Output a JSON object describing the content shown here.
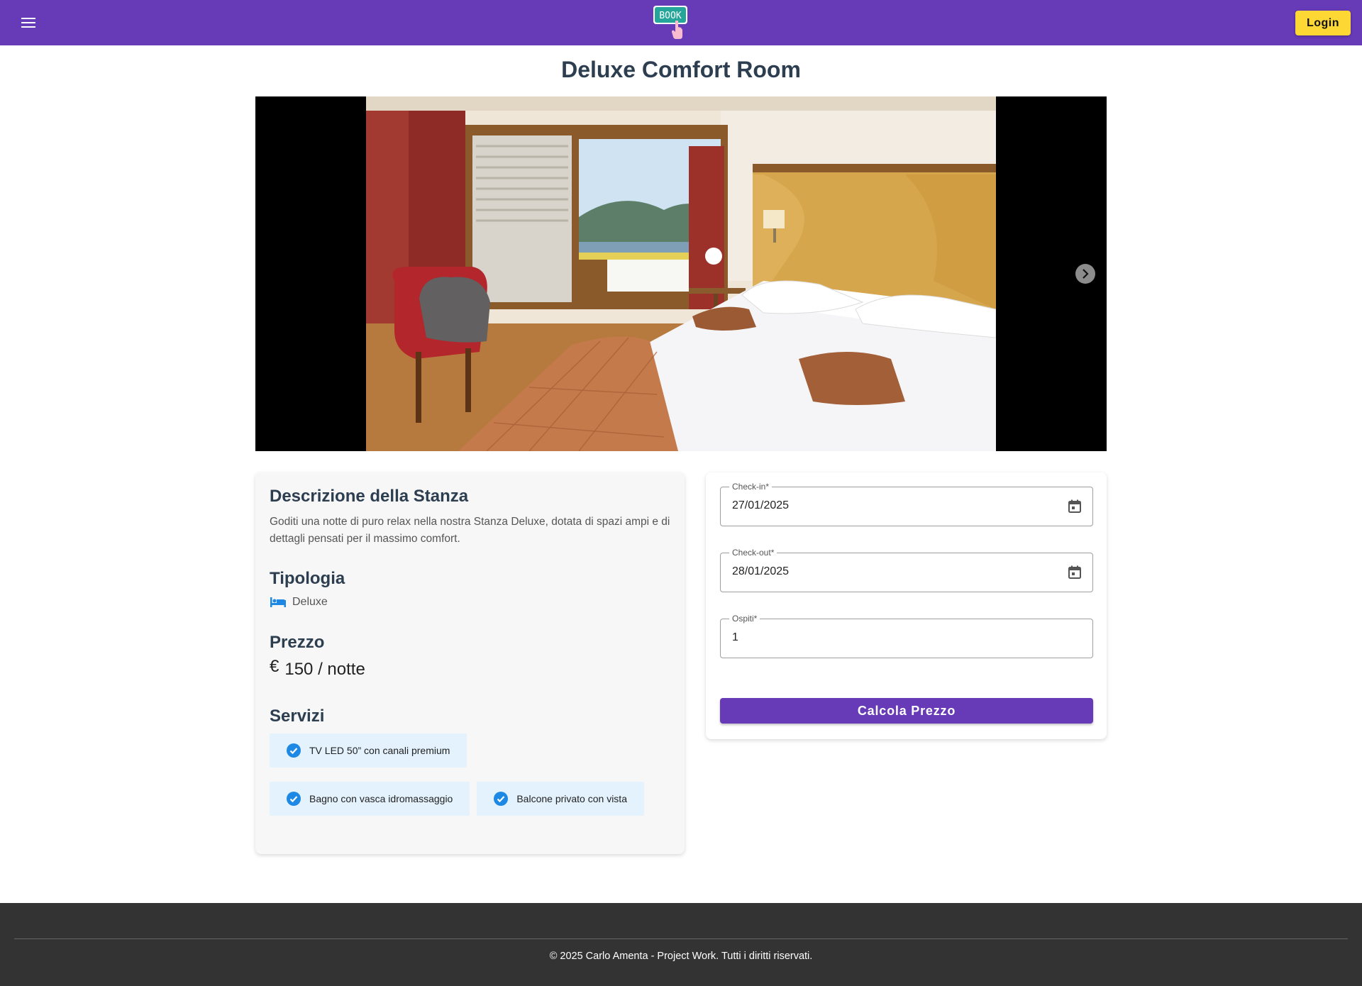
{
  "header": {
    "menu_icon": "menu-icon",
    "logo_text": "BOOK",
    "login_label": "Login",
    "colors": {
      "bar": "#673ab7",
      "login": "#fdd835"
    }
  },
  "room": {
    "title": "Deluxe Comfort Room",
    "carousel": {
      "next_icon": "chevron-right-icon"
    }
  },
  "info": {
    "description_title": "Descrizione della Stanza",
    "description_text": "Goditi una notte di puro relax nella nostra Stanza Deluxe, dotata di spazi ampi e di dettagli pensati per il massimo comfort.",
    "type_title": "Tipologia",
    "type_icon": "bed-icon",
    "type_value": "Deluxe",
    "price_title": "Prezzo",
    "price_currency": "€",
    "price_value": "150 / notte",
    "services_title": "Servizi",
    "services": [
      "TV LED 50” con canali premium",
      "Bagno con vasca idromassaggio",
      "Balcone privato con vista"
    ]
  },
  "booking": {
    "checkin_label": "Check-in*",
    "checkin_value": "27/01/2025",
    "checkout_label": "Check-out*",
    "checkout_value": "28/01/2025",
    "guests_label": "Ospiti*",
    "guests_value": "1",
    "calc_label": "Calcola Prezzo"
  },
  "footer": {
    "text": "© 2025 Carlo Amenta - Project Work. Tutti i diritti riservati."
  }
}
